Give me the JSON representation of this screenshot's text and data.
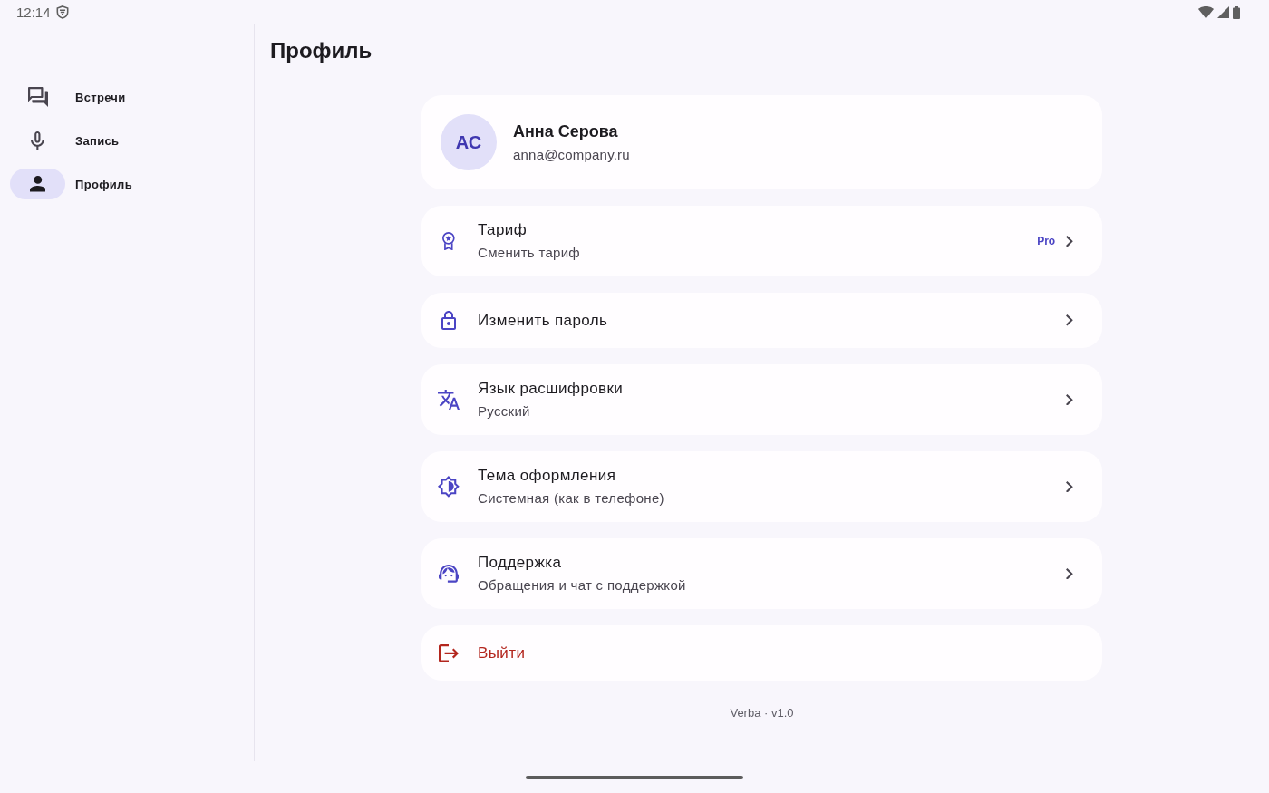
{
  "status_bar": {
    "time": "12:14"
  },
  "sidebar": {
    "items": [
      {
        "kind": "meetings",
        "label": "Встречи",
        "selected": false
      },
      {
        "kind": "recording",
        "label": "Запись",
        "selected": false
      },
      {
        "kind": "profile",
        "label": "Профиль",
        "selected": true
      }
    ]
  },
  "page": {
    "title": "Профиль"
  },
  "profile": {
    "initials": "АС",
    "name": "Анна Серова",
    "email": "anna@company.ru"
  },
  "settings": [
    {
      "kind": "plan",
      "title": "Тариф",
      "subtitle": "Сменить тариф",
      "badge": "Pro"
    },
    {
      "kind": "password",
      "title": "Изменить пароль"
    },
    {
      "kind": "language",
      "title": "Язык расшифровки",
      "subtitle": "Русский"
    },
    {
      "kind": "theme",
      "title": "Тема оформления",
      "subtitle": "Системная (как в телефоне)"
    },
    {
      "kind": "support",
      "title": "Поддержка",
      "subtitle": "Обращения и чат с поддержкой"
    }
  ],
  "logout": {
    "label": "Выйти"
  },
  "footer": {
    "version": "Verba · v1.0"
  }
}
